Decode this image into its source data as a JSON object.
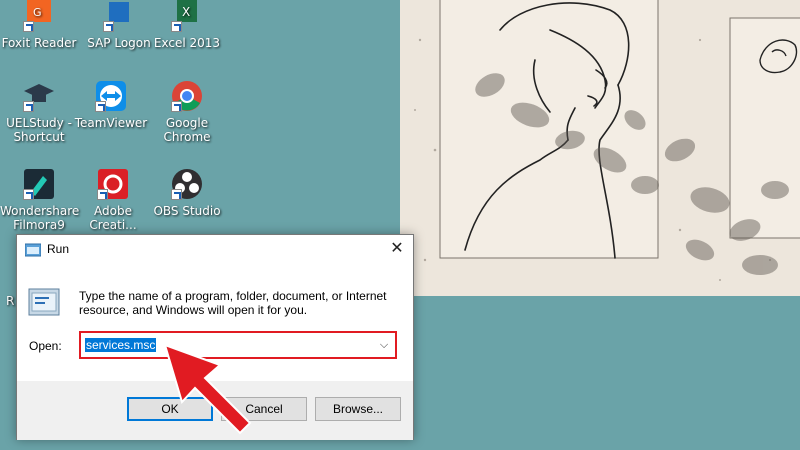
{
  "desktop": {
    "icons": [
      {
        "label": "Foxit Reader",
        "icon": "foxit-reader-icon",
        "color": "#f26522"
      },
      {
        "label": "SAP Logon",
        "icon": "sap-logon-icon",
        "color": "#1f6ebf"
      },
      {
        "label": "Excel 2013",
        "icon": "excel-icon",
        "color": "#1e7145"
      },
      {
        "label": "UELStudy - Shortcut",
        "icon": "graduation-cap-icon",
        "color": "#2b3a4a"
      },
      {
        "label": "TeamViewer",
        "icon": "teamviewer-icon",
        "color": "#0e8ee9"
      },
      {
        "label": "Google Chrome",
        "icon": "chrome-icon",
        "color": "#db4437"
      },
      {
        "label": "Wondershare Filmora9",
        "icon": "filmora-icon",
        "color": "#23c9b5"
      },
      {
        "label": "Adobe Creati...",
        "icon": "adobe-cc-icon",
        "color": "#da1f26"
      },
      {
        "label": "OBS Studio",
        "icon": "obs-studio-icon",
        "color": "#302e31"
      }
    ],
    "partial_label": "R"
  },
  "run_dialog": {
    "title": "Run",
    "description": "Type the name of a program, folder, document, or Internet resource, and Windows will open it for you.",
    "open_label": "Open:",
    "open_value": "services.msc",
    "ok_label": "OK",
    "cancel_label": "Cancel",
    "browse_label": "Browse...",
    "close_glyph": "✕",
    "dropdown_glyph": "⌵"
  },
  "colors": {
    "desktop_bg": "#6aa3a8",
    "highlight_red": "#e11b22",
    "selection_blue": "#0078d7"
  }
}
